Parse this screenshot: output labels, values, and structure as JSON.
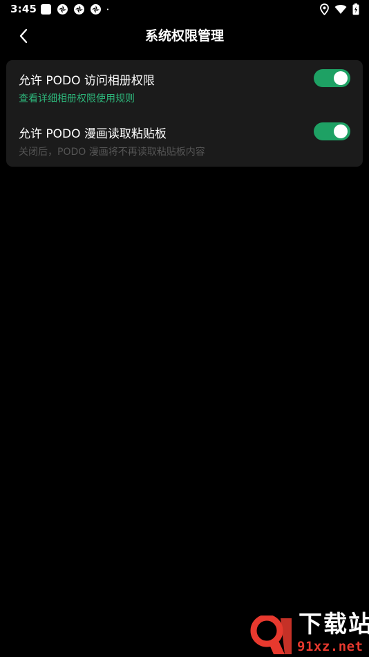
{
  "status_bar": {
    "time": "3:45",
    "notification_icons": [
      "square-app-icon",
      "aperture-icon",
      "aperture-icon",
      "aperture-icon",
      "dot-icon"
    ],
    "system_icons": [
      "location-icon",
      "wifi-icon",
      "battery-charging-icon"
    ]
  },
  "header": {
    "title": "系统权限管理",
    "back_icon": "chevron-left-icon"
  },
  "settings": [
    {
      "title": "允许 PODO 访问相册权限",
      "subtitle": "查看详细相册权限使用规则",
      "subtitle_style": "link",
      "enabled": true
    },
    {
      "title": "允许 PODO 漫画读取粘贴板",
      "subtitle": "关闭后，PODO 漫画将不再读取粘贴板内容",
      "subtitle_style": "muted",
      "enabled": true
    }
  ],
  "watermark": {
    "logo_text": "9",
    "cn_text": "下载站",
    "url_text": "91xz.net"
  },
  "colors": {
    "background": "#000000",
    "card": "#1b1b1b",
    "accent_green": "#1ea164",
    "link_green": "#2db67a",
    "muted_text": "#555555",
    "watermark_red": "#e8392e"
  }
}
